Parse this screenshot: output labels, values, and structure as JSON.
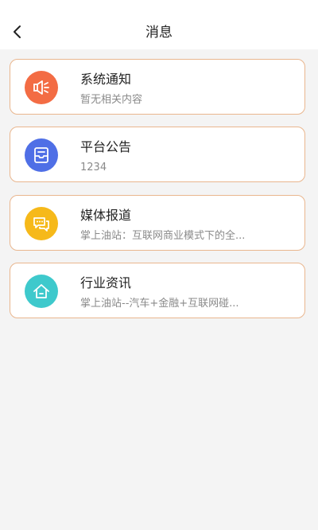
{
  "header": {
    "title": "消息",
    "back_icon": "chevron-left-icon"
  },
  "colors": {
    "card_border": "#e9b68e",
    "system_icon_bg": "#f36c44",
    "platform_icon_bg": "#4f6fe6",
    "media_icon_bg": "#f6b91a",
    "industry_icon_bg": "#3ec9cc"
  },
  "messages": [
    {
      "title": "系统通知",
      "subtitle": "暂无相关内容",
      "icon": "speaker-icon"
    },
    {
      "title": "平台公告",
      "subtitle": "1234",
      "icon": "inbox-icon"
    },
    {
      "title": "媒体报道",
      "subtitle": "掌上油站：互联网商业模式下的全...",
      "icon": "chat-icon"
    },
    {
      "title": "行业资讯",
      "subtitle": "掌上油站--汽车+金融+互联网碰...",
      "icon": "home-icon"
    }
  ]
}
